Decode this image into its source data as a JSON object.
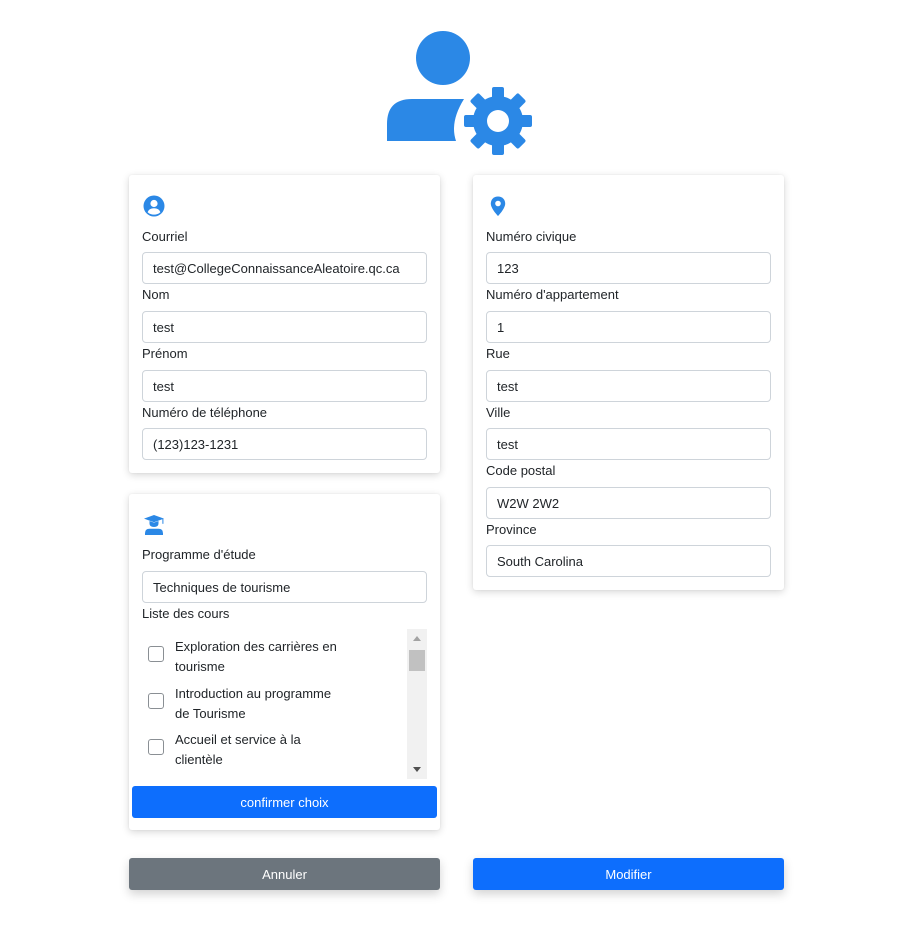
{
  "colors": {
    "accent": "#2b88e6",
    "primary": "#0d6efd",
    "secondary": "#6c757d"
  },
  "header": {
    "icon": "user-gear-icon"
  },
  "personal": {
    "icon": "user-circle-icon",
    "email_label": "Courriel",
    "email_value": "test@CollegeConnaissanceAleatoire.qc.ca",
    "last_name_label": "Nom",
    "last_name_value": "test",
    "first_name_label": "Prénom",
    "first_name_value": "test",
    "phone_label": "Numéro de téléphone",
    "phone_value": "(123)123-1231"
  },
  "address": {
    "icon": "map-pin-icon",
    "civic_label": "Numéro civique",
    "civic_value": "123",
    "apartment_label": "Numéro d'appartement",
    "apartment_value": "1",
    "street_label": "Rue",
    "street_value": "test",
    "city_label": "Ville",
    "city_value": "test",
    "postal_label": "Code postal",
    "postal_value": "W2W 2W2",
    "province_label": "Province",
    "province_value": "South Carolina"
  },
  "program": {
    "icon": "graduate-icon",
    "program_label": "Programme d'étude",
    "program_value": "Techniques de tourisme",
    "courses_label": "Liste des cours",
    "courses": [
      {
        "label": "Exploration des carrières en tourisme",
        "checked": false
      },
      {
        "label": "Introduction au programme de Tourisme",
        "checked": false
      },
      {
        "label": "Accueil et service à la clientèle",
        "checked": false
      }
    ],
    "confirm_label": "confirmer choix"
  },
  "actions": {
    "cancel_label": "Annuler",
    "modify_label": "Modifier"
  }
}
